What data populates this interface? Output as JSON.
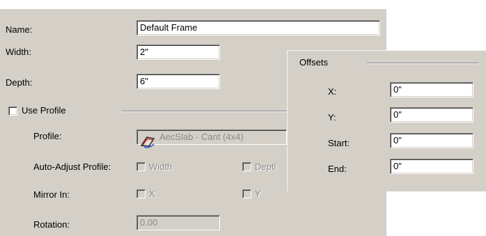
{
  "form": {
    "name_label": "Name:",
    "name_value": "Default Frame",
    "width_label": "Width:",
    "width_value": "2\"",
    "depth_label": "Depth:",
    "depth_value": "6\"",
    "use_profile_label": "Use Profile",
    "use_profile_checked": false,
    "profile_label": "Profile:",
    "profile_value": "AecSlab - Cant (4x4)",
    "profile_icon": "profile-shape-icon",
    "auto_adjust_label": "Auto-Adjust Profile:",
    "auto_adjust_width_label": "Width",
    "auto_adjust_depth_label": "Deptl",
    "mirror_label": "Mirror In:",
    "mirror_x_label": "X",
    "mirror_y_label": "Y",
    "rotation_label": "Rotation:",
    "rotation_value": "0.00"
  },
  "offsets": {
    "title": "Offsets",
    "x_label": "X:",
    "x_value": "0\"",
    "y_label": "Y:",
    "y_value": "0\"",
    "start_label": "Start:",
    "start_value": "0\"",
    "end_label": "End:",
    "end_value": "0\""
  },
  "colors": {
    "dialog_face": "#d4d0c8",
    "disabled_text": "#8a8a8a",
    "field_background": "#ffffff"
  }
}
